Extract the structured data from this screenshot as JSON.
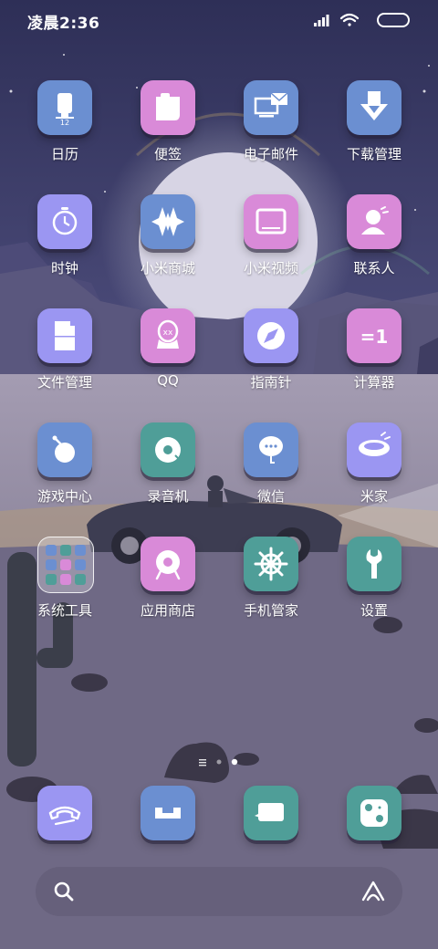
{
  "status_bar": {
    "time": "凌晨2:36"
  },
  "apps": [
    {
      "label": "日历",
      "icon": "calendar-icon",
      "color": "#6b8fd1",
      "badge": "12"
    },
    {
      "label": "便签",
      "icon": "notes-icon",
      "color": "#d98ad8"
    },
    {
      "label": "电子邮件",
      "icon": "email-icon",
      "color": "#6b8fd1"
    },
    {
      "label": "下载管理",
      "icon": "download-icon",
      "color": "#6b8fd1"
    },
    {
      "label": "时钟",
      "icon": "clock-icon",
      "color": "#9b96f2"
    },
    {
      "label": "小米商城",
      "icon": "mi-store-icon",
      "color": "#6b8fd1"
    },
    {
      "label": "小米视频",
      "icon": "video-icon",
      "color": "#d98ad8"
    },
    {
      "label": "联系人",
      "icon": "contacts-icon",
      "color": "#d98ad8"
    },
    {
      "label": "文件管理",
      "icon": "file-manager-icon",
      "color": "#9b96f2"
    },
    {
      "label": "QQ",
      "icon": "qq-icon",
      "color": "#d98ad8"
    },
    {
      "label": "指南针",
      "icon": "compass-icon",
      "color": "#9b96f2"
    },
    {
      "label": "计算器",
      "icon": "calculator-icon",
      "color": "#d98ad8",
      "glyph": "=1"
    },
    {
      "label": "游戏中心",
      "icon": "game-center-icon",
      "color": "#6b8fd1"
    },
    {
      "label": "录音机",
      "icon": "recorder-icon",
      "color": "#4f9e98"
    },
    {
      "label": "微信",
      "icon": "wechat-icon",
      "color": "#6b8fd1"
    },
    {
      "label": "米家",
      "icon": "mijia-icon",
      "color": "#9b96f2"
    },
    {
      "label": "系统工具",
      "icon": "folder-icon",
      "color": "#ffffff"
    },
    {
      "label": "应用商店",
      "icon": "app-store-icon",
      "color": "#d98ad8"
    },
    {
      "label": "手机管家",
      "icon": "security-icon",
      "color": "#4f9e98"
    },
    {
      "label": "设置",
      "icon": "settings-icon",
      "color": "#4f9e98"
    }
  ],
  "dock": [
    {
      "icon": "phone-icon",
      "color": "#9b96f2"
    },
    {
      "icon": "messages-icon",
      "color": "#6b8fd1"
    },
    {
      "icon": "chat-bubble-icon",
      "color": "#4f9e98"
    },
    {
      "icon": "camera-icon",
      "color": "#4f9e98"
    }
  ],
  "page_indicator": {
    "pages": 2,
    "current": 2
  },
  "search_bar": {
    "icon": "search-icon",
    "right_icon": "xiaoai-icon"
  }
}
